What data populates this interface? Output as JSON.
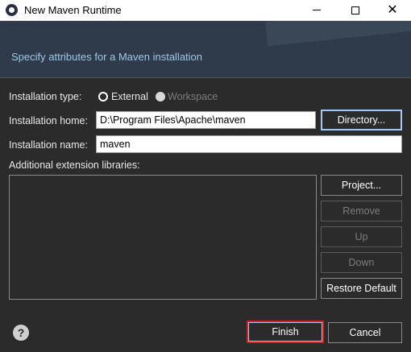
{
  "window": {
    "title": "New Maven Runtime"
  },
  "header": {
    "description": "Specify attributes for a Maven installation"
  },
  "form": {
    "installation_type_label": "Installation type:",
    "type_external": "External",
    "type_workspace": "Workspace",
    "installation_home_label": "Installation home:",
    "installation_home_value": "D:\\Program Files\\Apache\\maven",
    "directory_button": "Directory...",
    "installation_name_label": "Installation name:",
    "installation_name_value": "maven",
    "extensions_label": "Additional extension libraries:"
  },
  "side_buttons": {
    "project": "Project...",
    "remove": "Remove",
    "up": "Up",
    "down": "Down",
    "restore": "Restore Default"
  },
  "footer": {
    "finish": "Finish",
    "cancel": "Cancel"
  },
  "icons": {
    "app": "eclipse-icon",
    "help": "help-icon"
  },
  "colors": {
    "header_bg": "#2f3b4a",
    "header_text": "#9ec8e6",
    "body_bg": "#2b2b2b",
    "focus_border": "#a8c8f0",
    "highlight": "#d42020"
  }
}
